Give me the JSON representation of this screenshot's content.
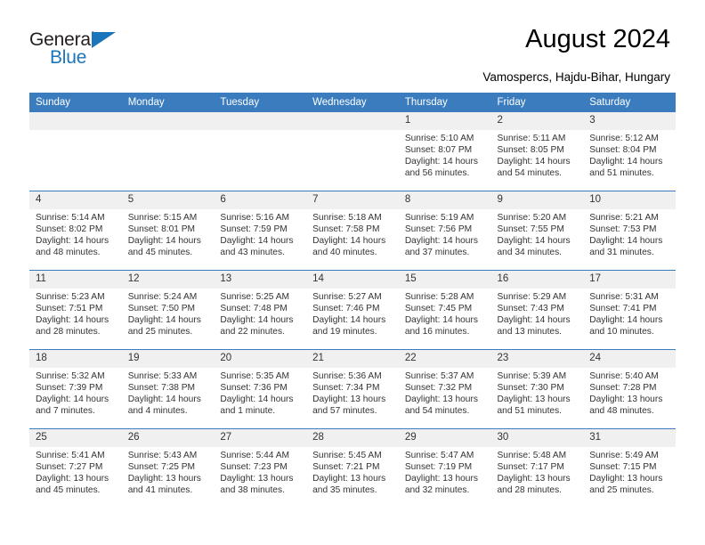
{
  "brand": {
    "name_part1": "General",
    "name_part2": "Blue",
    "accent_color": "#1b75bb"
  },
  "header": {
    "title": "August 2024",
    "subtitle": "Vamospercs, Hajdu-Bihar, Hungary"
  },
  "calendar": {
    "header_bg": "#3a7cbe",
    "daynum_bg": "#f0f0f0",
    "weekdays": [
      "Sunday",
      "Monday",
      "Tuesday",
      "Wednesday",
      "Thursday",
      "Friday",
      "Saturday"
    ],
    "weeks": [
      [
        {
          "day": "",
          "blank": true
        },
        {
          "day": "",
          "blank": true
        },
        {
          "day": "",
          "blank": true
        },
        {
          "day": "",
          "blank": true
        },
        {
          "day": "1",
          "sunrise": "Sunrise: 5:10 AM",
          "sunset": "Sunset: 8:07 PM",
          "daylight1": "Daylight: 14 hours",
          "daylight2": "and 56 minutes."
        },
        {
          "day": "2",
          "sunrise": "Sunrise: 5:11 AM",
          "sunset": "Sunset: 8:05 PM",
          "daylight1": "Daylight: 14 hours",
          "daylight2": "and 54 minutes."
        },
        {
          "day": "3",
          "sunrise": "Sunrise: 5:12 AM",
          "sunset": "Sunset: 8:04 PM",
          "daylight1": "Daylight: 14 hours",
          "daylight2": "and 51 minutes."
        }
      ],
      [
        {
          "day": "4",
          "sunrise": "Sunrise: 5:14 AM",
          "sunset": "Sunset: 8:02 PM",
          "daylight1": "Daylight: 14 hours",
          "daylight2": "and 48 minutes."
        },
        {
          "day": "5",
          "sunrise": "Sunrise: 5:15 AM",
          "sunset": "Sunset: 8:01 PM",
          "daylight1": "Daylight: 14 hours",
          "daylight2": "and 45 minutes."
        },
        {
          "day": "6",
          "sunrise": "Sunrise: 5:16 AM",
          "sunset": "Sunset: 7:59 PM",
          "daylight1": "Daylight: 14 hours",
          "daylight2": "and 43 minutes."
        },
        {
          "day": "7",
          "sunrise": "Sunrise: 5:18 AM",
          "sunset": "Sunset: 7:58 PM",
          "daylight1": "Daylight: 14 hours",
          "daylight2": "and 40 minutes."
        },
        {
          "day": "8",
          "sunrise": "Sunrise: 5:19 AM",
          "sunset": "Sunset: 7:56 PM",
          "daylight1": "Daylight: 14 hours",
          "daylight2": "and 37 minutes."
        },
        {
          "day": "9",
          "sunrise": "Sunrise: 5:20 AM",
          "sunset": "Sunset: 7:55 PM",
          "daylight1": "Daylight: 14 hours",
          "daylight2": "and 34 minutes."
        },
        {
          "day": "10",
          "sunrise": "Sunrise: 5:21 AM",
          "sunset": "Sunset: 7:53 PM",
          "daylight1": "Daylight: 14 hours",
          "daylight2": "and 31 minutes."
        }
      ],
      [
        {
          "day": "11",
          "sunrise": "Sunrise: 5:23 AM",
          "sunset": "Sunset: 7:51 PM",
          "daylight1": "Daylight: 14 hours",
          "daylight2": "and 28 minutes."
        },
        {
          "day": "12",
          "sunrise": "Sunrise: 5:24 AM",
          "sunset": "Sunset: 7:50 PM",
          "daylight1": "Daylight: 14 hours",
          "daylight2": "and 25 minutes."
        },
        {
          "day": "13",
          "sunrise": "Sunrise: 5:25 AM",
          "sunset": "Sunset: 7:48 PM",
          "daylight1": "Daylight: 14 hours",
          "daylight2": "and 22 minutes."
        },
        {
          "day": "14",
          "sunrise": "Sunrise: 5:27 AM",
          "sunset": "Sunset: 7:46 PM",
          "daylight1": "Daylight: 14 hours",
          "daylight2": "and 19 minutes."
        },
        {
          "day": "15",
          "sunrise": "Sunrise: 5:28 AM",
          "sunset": "Sunset: 7:45 PM",
          "daylight1": "Daylight: 14 hours",
          "daylight2": "and 16 minutes."
        },
        {
          "day": "16",
          "sunrise": "Sunrise: 5:29 AM",
          "sunset": "Sunset: 7:43 PM",
          "daylight1": "Daylight: 14 hours",
          "daylight2": "and 13 minutes."
        },
        {
          "day": "17",
          "sunrise": "Sunrise: 5:31 AM",
          "sunset": "Sunset: 7:41 PM",
          "daylight1": "Daylight: 14 hours",
          "daylight2": "and 10 minutes."
        }
      ],
      [
        {
          "day": "18",
          "sunrise": "Sunrise: 5:32 AM",
          "sunset": "Sunset: 7:39 PM",
          "daylight1": "Daylight: 14 hours",
          "daylight2": "and 7 minutes."
        },
        {
          "day": "19",
          "sunrise": "Sunrise: 5:33 AM",
          "sunset": "Sunset: 7:38 PM",
          "daylight1": "Daylight: 14 hours",
          "daylight2": "and 4 minutes."
        },
        {
          "day": "20",
          "sunrise": "Sunrise: 5:35 AM",
          "sunset": "Sunset: 7:36 PM",
          "daylight1": "Daylight: 14 hours",
          "daylight2": "and 1 minute."
        },
        {
          "day": "21",
          "sunrise": "Sunrise: 5:36 AM",
          "sunset": "Sunset: 7:34 PM",
          "daylight1": "Daylight: 13 hours",
          "daylight2": "and 57 minutes."
        },
        {
          "day": "22",
          "sunrise": "Sunrise: 5:37 AM",
          "sunset": "Sunset: 7:32 PM",
          "daylight1": "Daylight: 13 hours",
          "daylight2": "and 54 minutes."
        },
        {
          "day": "23",
          "sunrise": "Sunrise: 5:39 AM",
          "sunset": "Sunset: 7:30 PM",
          "daylight1": "Daylight: 13 hours",
          "daylight2": "and 51 minutes."
        },
        {
          "day": "24",
          "sunrise": "Sunrise: 5:40 AM",
          "sunset": "Sunset: 7:28 PM",
          "daylight1": "Daylight: 13 hours",
          "daylight2": "and 48 minutes."
        }
      ],
      [
        {
          "day": "25",
          "sunrise": "Sunrise: 5:41 AM",
          "sunset": "Sunset: 7:27 PM",
          "daylight1": "Daylight: 13 hours",
          "daylight2": "and 45 minutes."
        },
        {
          "day": "26",
          "sunrise": "Sunrise: 5:43 AM",
          "sunset": "Sunset: 7:25 PM",
          "daylight1": "Daylight: 13 hours",
          "daylight2": "and 41 minutes."
        },
        {
          "day": "27",
          "sunrise": "Sunrise: 5:44 AM",
          "sunset": "Sunset: 7:23 PM",
          "daylight1": "Daylight: 13 hours",
          "daylight2": "and 38 minutes."
        },
        {
          "day": "28",
          "sunrise": "Sunrise: 5:45 AM",
          "sunset": "Sunset: 7:21 PM",
          "daylight1": "Daylight: 13 hours",
          "daylight2": "and 35 minutes."
        },
        {
          "day": "29",
          "sunrise": "Sunrise: 5:47 AM",
          "sunset": "Sunset: 7:19 PM",
          "daylight1": "Daylight: 13 hours",
          "daylight2": "and 32 minutes."
        },
        {
          "day": "30",
          "sunrise": "Sunrise: 5:48 AM",
          "sunset": "Sunset: 7:17 PM",
          "daylight1": "Daylight: 13 hours",
          "daylight2": "and 28 minutes."
        },
        {
          "day": "31",
          "sunrise": "Sunrise: 5:49 AM",
          "sunset": "Sunset: 7:15 PM",
          "daylight1": "Daylight: 13 hours",
          "daylight2": "and 25 minutes."
        }
      ]
    ]
  }
}
